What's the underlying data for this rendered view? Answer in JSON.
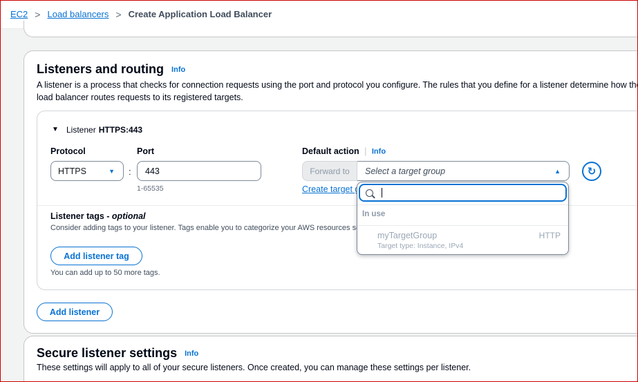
{
  "breadcrumb": {
    "items": [
      "EC2",
      "Load balancers"
    ],
    "current": "Create Application Load Balancer",
    "separator": ">"
  },
  "listeners_panel": {
    "title": "Listeners and routing",
    "info": "Info",
    "description": "A listener is a process that checks for connection requests using the port and protocol you configure. The rules that you define for a listener determine how the load balancer routes requests to its registered targets."
  },
  "listener": {
    "label": "Listener",
    "value": "HTTPS:443",
    "protocol_label": "Protocol",
    "protocol_value": "HTTPS",
    "port_label": "Port",
    "port_value": "443",
    "port_hint": "1-65535",
    "default_action_label": "Default action",
    "default_action_info": "Info",
    "forward_to": "Forward to",
    "target_placeholder": "Select a target group",
    "create_target_link": "Create target group",
    "tags_title": "Listener tags - ",
    "tags_optional": "optional",
    "tags_desc": "Consider adding tags to your listener. Tags enable you to categorize your AWS resources so you can more easily manage them.",
    "add_tag_button": "Add listener tag",
    "more_tags_hint": "You can add up to 50 more tags."
  },
  "add_listener_button": "Add listener",
  "secure_panel": {
    "title": "Secure listener settings",
    "info": "Info",
    "description": "These settings will apply to all of your secure listeners. Once created, you can manage these settings per listener."
  },
  "dropdown": {
    "search_value": "",
    "group": "In use",
    "options": [
      {
        "name": "myTargetGroup",
        "protocol": "HTTP",
        "detail": "Target type: Instance, IPv4"
      }
    ]
  },
  "colors": {
    "link": "#0972d3",
    "border": "#7d8998",
    "frame": "#cc0000"
  }
}
